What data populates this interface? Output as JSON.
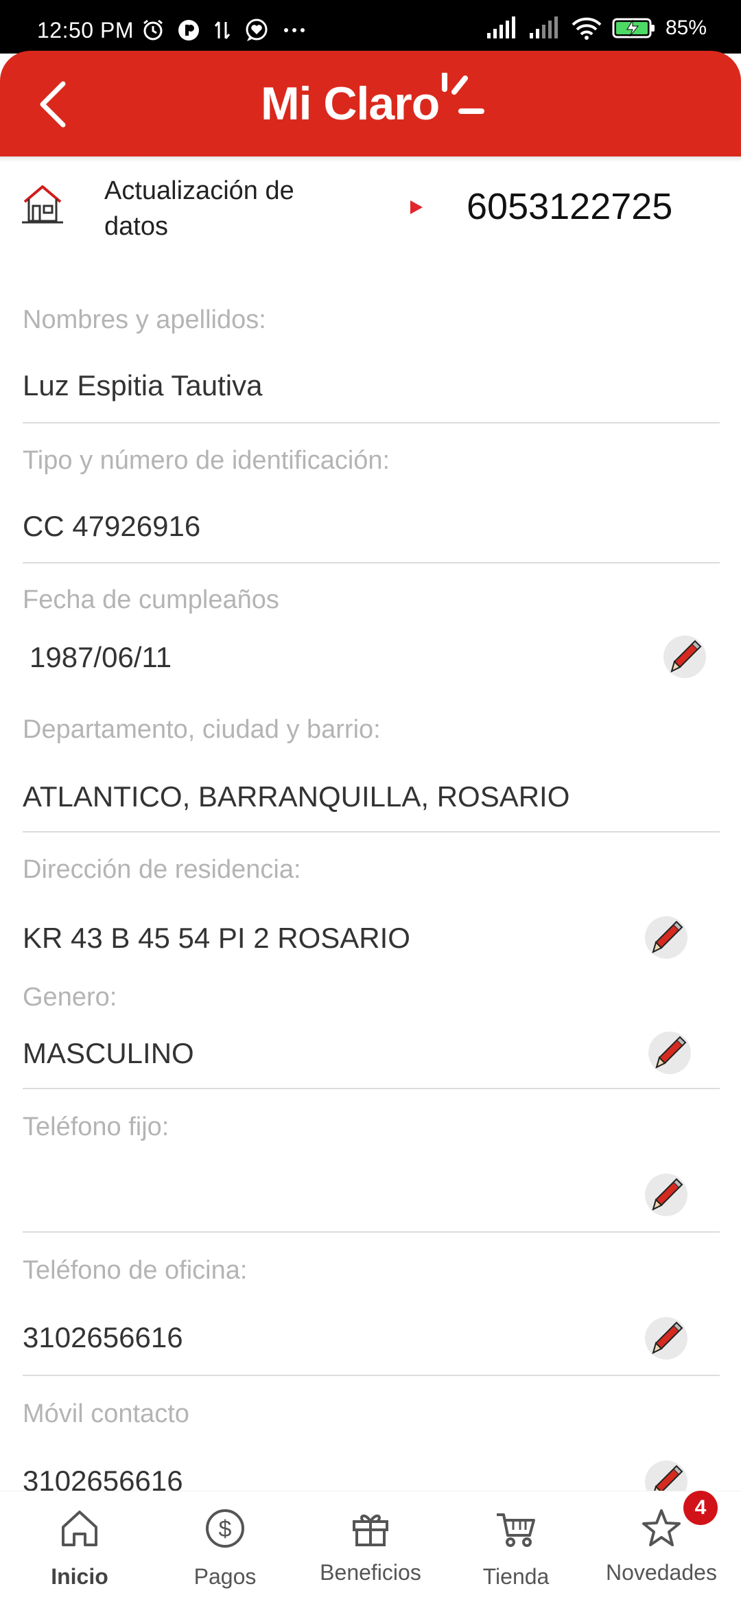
{
  "status_bar": {
    "time": "12:50 PM",
    "battery": "85%",
    "icons": [
      "alarm-icon",
      "app-icon",
      "data-transfer-icon",
      "heart-chat-icon",
      "more-icon",
      "signal-icon",
      "signal-icon-2",
      "wifi-icon",
      "battery-icon"
    ]
  },
  "header": {
    "brand": "Mi Claro",
    "back_icon": "chevron-left-icon",
    "color": "#da291c"
  },
  "info": {
    "title": "Actualización de datos",
    "line_number": "6053122725",
    "icon": "house-icon"
  },
  "fields": [
    {
      "label": "Nombres y apellidos:",
      "value": "Luz Espitia Tautiva",
      "editable": false
    },
    {
      "label": "Tipo y número de identificación:",
      "value": "CC 47926916",
      "editable": false
    },
    {
      "label": "Fecha de cumpleaños",
      "value": "1987/06/11",
      "editable": true
    },
    {
      "label": "Departamento, ciudad y barrio:",
      "value": "ATLANTICO, BARRANQUILLA, ROSARIO",
      "editable": false
    },
    {
      "label": "Dirección de residencia:",
      "value": "KR 43 B 45 54 PI 2 ROSARIO",
      "editable": true
    },
    {
      "label": "Genero:",
      "value": "MASCULINO",
      "editable": true
    },
    {
      "label": "Teléfono fijo:",
      "value": "",
      "editable": true
    },
    {
      "label": "Teléfono de oficina:",
      "value": "3102656616",
      "editable": true
    },
    {
      "label": "Móvil contacto",
      "value": "3102656616",
      "editable": true
    }
  ],
  "bottom_nav": {
    "items": [
      {
        "label": "Inicio",
        "icon": "home-icon",
        "active": true
      },
      {
        "label": "Pagos",
        "icon": "dollar-icon",
        "active": false
      },
      {
        "label": "Beneficios",
        "icon": "gift-icon",
        "active": false
      },
      {
        "label": "Tienda",
        "icon": "cart-icon",
        "active": false
      },
      {
        "label": "Novedades",
        "icon": "star-icon",
        "active": false
      }
    ],
    "badge": "4"
  }
}
